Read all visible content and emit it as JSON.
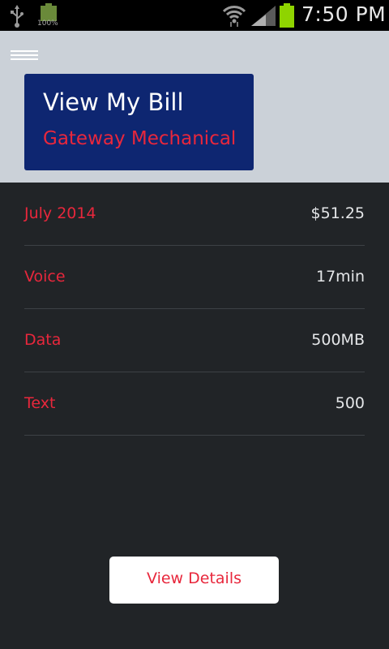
{
  "status_bar": {
    "time": "7:50 PM",
    "battery_small_label": "100%",
    "icons": [
      "usb-icon",
      "battery-full-icon",
      "wifi-icon",
      "signal-icon",
      "battery-icon"
    ],
    "colors": {
      "battery_green": "#8fd400",
      "icon_gray": "#9a9a9a"
    }
  },
  "header": {
    "menu_icon": "hamburger-menu-icon",
    "title": "View My Bill",
    "subtitle": "Gateway Mechanical",
    "colors": {
      "background": "#cbd1d8",
      "card": "#0e2671",
      "accent": "#e8273c"
    }
  },
  "bill": {
    "rows": [
      {
        "label": "July 2014",
        "value": "$51.25"
      },
      {
        "label": "Voice",
        "value": "17min"
      },
      {
        "label": "Data",
        "value": "500MB"
      },
      {
        "label": "Text",
        "value": "500"
      }
    ]
  },
  "actions": {
    "view_details_label": "View Details"
  },
  "colors": {
    "page_background": "#212427",
    "divider": "#3d4145"
  }
}
